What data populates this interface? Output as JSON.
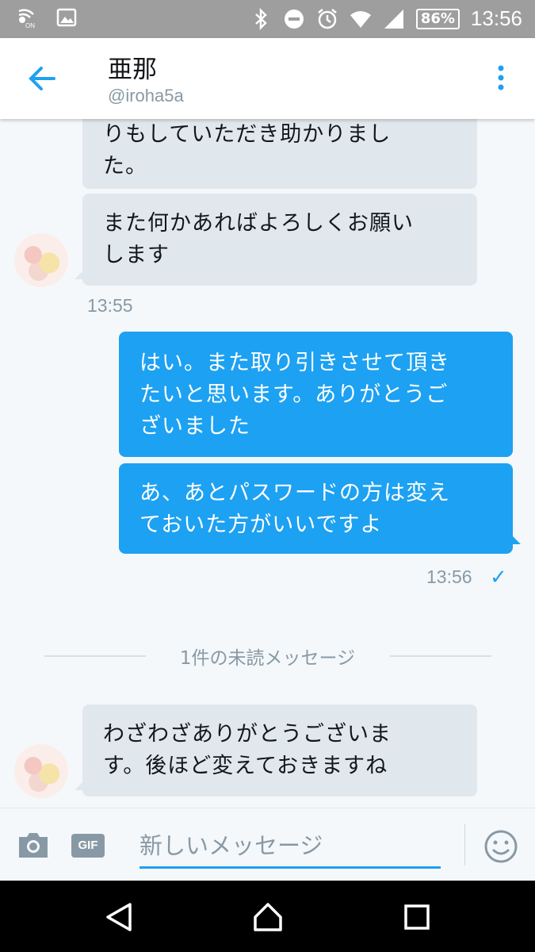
{
  "status_bar": {
    "battery": "86%",
    "time": "13:56",
    "icons": [
      "signal-on-icon",
      "image-icon",
      "bluetooth-icon",
      "do-not-disturb-icon",
      "alarm-icon",
      "wifi-icon",
      "cell-signal-icon",
      "battery-icon"
    ]
  },
  "header": {
    "name": "亜那",
    "handle": "@iroha5a",
    "back_icon": "back-arrow-icon",
    "menu_icon": "more-vertical-icon"
  },
  "messages": [
    {
      "direction": "in",
      "lines": [
        "りもしていただき助かりまし",
        "た。"
      ]
    },
    {
      "direction": "in",
      "lines": [
        "また何かあればよろしくお願い",
        "します"
      ]
    },
    {
      "direction": "in_time",
      "text": "13:55"
    },
    {
      "direction": "out",
      "lines": [
        "はい。また取り引きさせて頂き",
        "たいと思います。ありがとうご",
        "ざいました"
      ]
    },
    {
      "direction": "out",
      "lines": [
        "あ、あとパスワードの方は変え",
        "ておいた方がいいですよ"
      ]
    },
    {
      "direction": "out_time",
      "text": "13:56",
      "check": "✓"
    },
    {
      "direction": "unread",
      "text": "1件の未読メッセージ"
    },
    {
      "direction": "in",
      "lines": [
        "わざわざありがとうございま",
        "す。後ほど変えておきますね"
      ]
    }
  ],
  "composer": {
    "gif_label": "GIF",
    "placeholder": "新しいメッセージ"
  },
  "colors": {
    "accent": "#1da1f2",
    "incoming_bubble": "#e1e8ed",
    "status_bar": "#9e9e9e",
    "nav_bar": "#000000"
  }
}
